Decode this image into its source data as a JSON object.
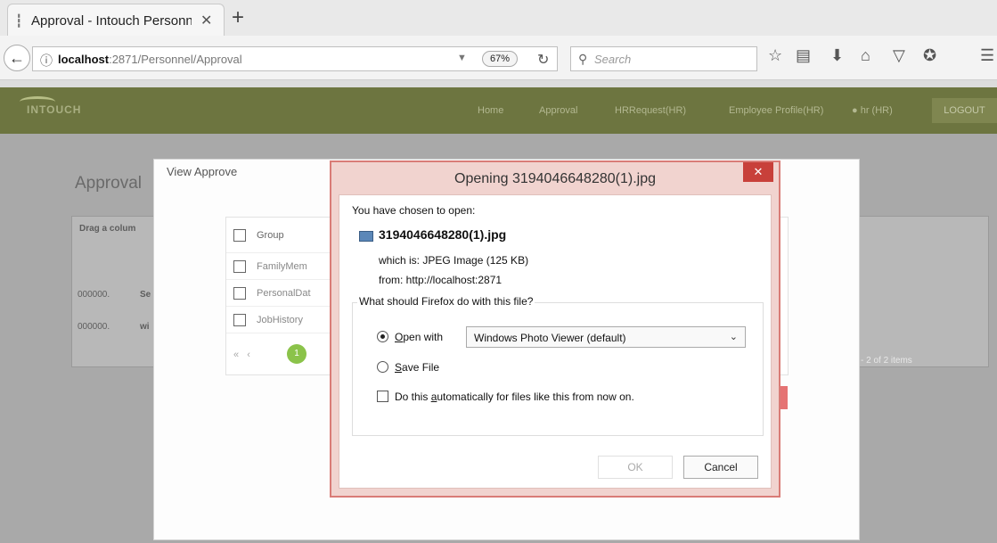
{
  "browser": {
    "tab_title": "Approval - Intouch Personn",
    "url_host": "localhost",
    "url_rest": ":2871/Personnel/Approval",
    "zoom": "67%",
    "search_placeholder": "Search"
  },
  "site": {
    "logo": "INTOUCH",
    "nav": [
      "Home",
      "Approval",
      "HRRequest(HR)",
      "Employee Profile(HR)",
      " hr (HR)"
    ],
    "logout": "LOGOUT"
  },
  "page": {
    "title": "Approval",
    "drag_hint": "Drag a colum",
    "rows": [
      {
        "id": "000000.",
        "short": "Se"
      },
      {
        "id": "000000.",
        "short": "wi"
      }
    ],
    "items_info": "- 2 of 2 items",
    "page": "1"
  },
  "view_dialog": {
    "title": "View Approve",
    "header": "Group",
    "rows": [
      "FamilyMem",
      "PersonalDat",
      "JobHistory"
    ],
    "page": "1"
  },
  "ff_dialog": {
    "title": "Opening 3194046648280(1).jpg",
    "chosen_label": "You have chosen to open:",
    "file_name": "3194046648280(1).jpg",
    "which_is": "which is:  JPEG Image (125 KB)",
    "from": "from:  http://localhost:2871",
    "question": "What should Firefox do with this file?",
    "open_with_pre": "",
    "open_with_key": "O",
    "open_with_rest": "pen with",
    "app_selected": "Windows Photo Viewer (default)",
    "save_key": "S",
    "save_rest": "ave File",
    "auto_pre": "Do this ",
    "auto_key": "a",
    "auto_rest": "utomatically for files like this from now on.",
    "ok": "OK",
    "cancel": "Cancel"
  }
}
